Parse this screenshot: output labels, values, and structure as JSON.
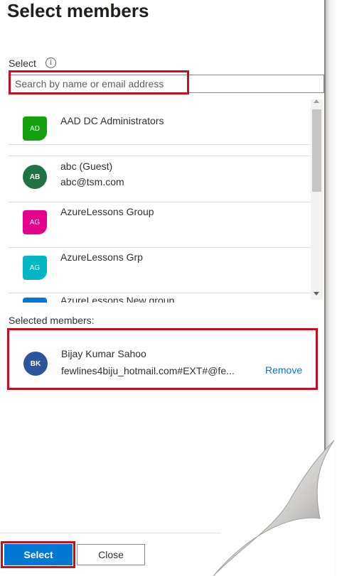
{
  "title": "Select members",
  "select_label": "Select",
  "info_icon": "info-icon",
  "search": {
    "placeholder": "Search by name or email address",
    "value": ""
  },
  "list": [
    {
      "initials": "AD",
      "name": "AAD DC Administrators",
      "sub": "",
      "color": "#13a10e",
      "shape": "square"
    },
    {
      "initials": "AB",
      "name": "abc (Guest)",
      "sub": "abc@tsm.com",
      "color": "#217346",
      "shape": "circle"
    },
    {
      "initials": "AG",
      "name": "AzureLessons Group",
      "sub": "",
      "color": "#e3008c",
      "shape": "square"
    },
    {
      "initials": "AG",
      "name": "AzureLessons Grp",
      "sub": "",
      "color": "#00b7c3",
      "shape": "square"
    },
    {
      "initials": "",
      "name": "AzureLessons New group",
      "sub": "",
      "color": "#0078d4",
      "shape": "square"
    }
  ],
  "selected_label": "Selected members:",
  "selected": {
    "initials": "BK",
    "name": "Bijay Kumar Sahoo",
    "email": "fewlines4biju_hotmail.com#EXT#@fe...",
    "remove_label": "Remove",
    "color": "#2b579a"
  },
  "buttons": {
    "select": "Select",
    "close": "Close"
  },
  "colors": {
    "accent": "#0078d4",
    "highlight": "#c50f1f"
  }
}
